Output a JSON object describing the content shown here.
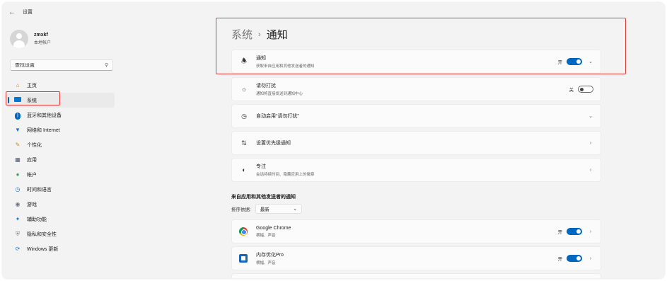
{
  "window": {
    "title": "设置",
    "back_glyph": "←"
  },
  "user": {
    "name": "zmxkf",
    "type": "本地帐户"
  },
  "search": {
    "placeholder": "查找设置",
    "value": "查找设置"
  },
  "nav": {
    "items": [
      {
        "label": "主页",
        "icon": "home-icon"
      },
      {
        "label": "系统",
        "icon": "system-icon",
        "active": true
      },
      {
        "label": "蓝牙和其他设备",
        "icon": "bluetooth-icon"
      },
      {
        "label": "网络和 Internet",
        "icon": "network-icon"
      },
      {
        "label": "个性化",
        "icon": "brush-icon"
      },
      {
        "label": "应用",
        "icon": "apps-icon"
      },
      {
        "label": "帐户",
        "icon": "account-icon"
      },
      {
        "label": "时间和语言",
        "icon": "globe-clock-icon"
      },
      {
        "label": "游戏",
        "icon": "gamepad-icon"
      },
      {
        "label": "辅助功能",
        "icon": "accessibility-icon"
      },
      {
        "label": "隐私和安全性",
        "icon": "shield-icon"
      },
      {
        "label": "Windows 更新",
        "icon": "update-icon"
      }
    ]
  },
  "breadcrumb": {
    "parent": "系统",
    "separator": "›",
    "current": "通知"
  },
  "cards": {
    "notifications": {
      "title": "通知",
      "subtitle": "获取来自应用和其他发送者的通知",
      "toggle_label": "开",
      "toggle_on": true
    },
    "dnd": {
      "title": "请勿打扰",
      "subtitle": "通知将直接发送到通知中心",
      "toggle_label": "关",
      "toggle_on": false
    },
    "auto_dnd": {
      "title": "自动启用“请勿打扰”"
    },
    "priority": {
      "title": "设置优先级通知"
    },
    "focus": {
      "title": "专注",
      "subtitle": "会话持续时间、隐藏应用上的徽章"
    }
  },
  "apps_section": {
    "title": "来自应用和其他发送者的通知",
    "sort_label": "排序依据:",
    "sort_value": "最新",
    "apps": [
      {
        "name": "Google Chrome",
        "subtitle": "横幅、声音",
        "toggle_label": "开",
        "icon": "chrome-icon"
      },
      {
        "name": "内存优化Pro",
        "subtitle": "横幅、声音",
        "toggle_label": "开",
        "icon": "memory-optimizer-icon"
      }
    ]
  },
  "colors": {
    "accent": "#0067c0",
    "highlight": "#e23b3b",
    "background": "#f3f3f3"
  }
}
